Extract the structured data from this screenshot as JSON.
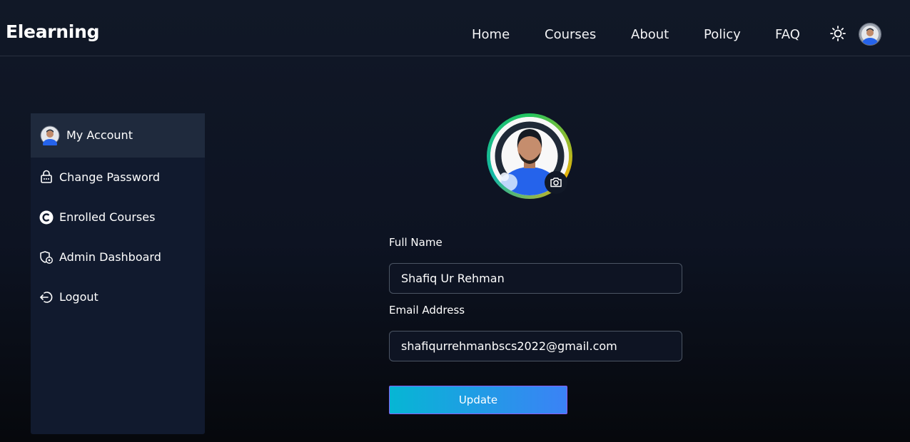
{
  "header": {
    "logo": "Elearning",
    "nav": [
      "Home",
      "Courses",
      "About",
      "Policy",
      "FAQ"
    ],
    "theme_icon": "sun-icon",
    "avatar_icon": "user-avatar"
  },
  "sidebar": {
    "items": [
      {
        "label": "My Account",
        "icon": "avatar-icon"
      },
      {
        "label": "Change Password",
        "icon": "lock-icon"
      },
      {
        "label": "Enrolled Courses",
        "icon": "course-icon"
      },
      {
        "label": "Admin Dashboard",
        "icon": "shield-gear-icon"
      },
      {
        "label": "Logout",
        "icon": "logout-icon"
      }
    ]
  },
  "profile": {
    "camera_icon": "camera-icon"
  },
  "form": {
    "full_name_label": "Full Name",
    "full_name_value": "Shafiq Ur Rehman",
    "email_label": "Email Address",
    "email_value": "shafiqurrehmanbscs2022@gmail.com",
    "update_label": "Update"
  },
  "colors": {
    "accent_start": "#06b6d4",
    "accent_end": "#3b82f6",
    "sidebar_bg": "#111a2e",
    "active_item_bg": "#1f2a3d"
  }
}
